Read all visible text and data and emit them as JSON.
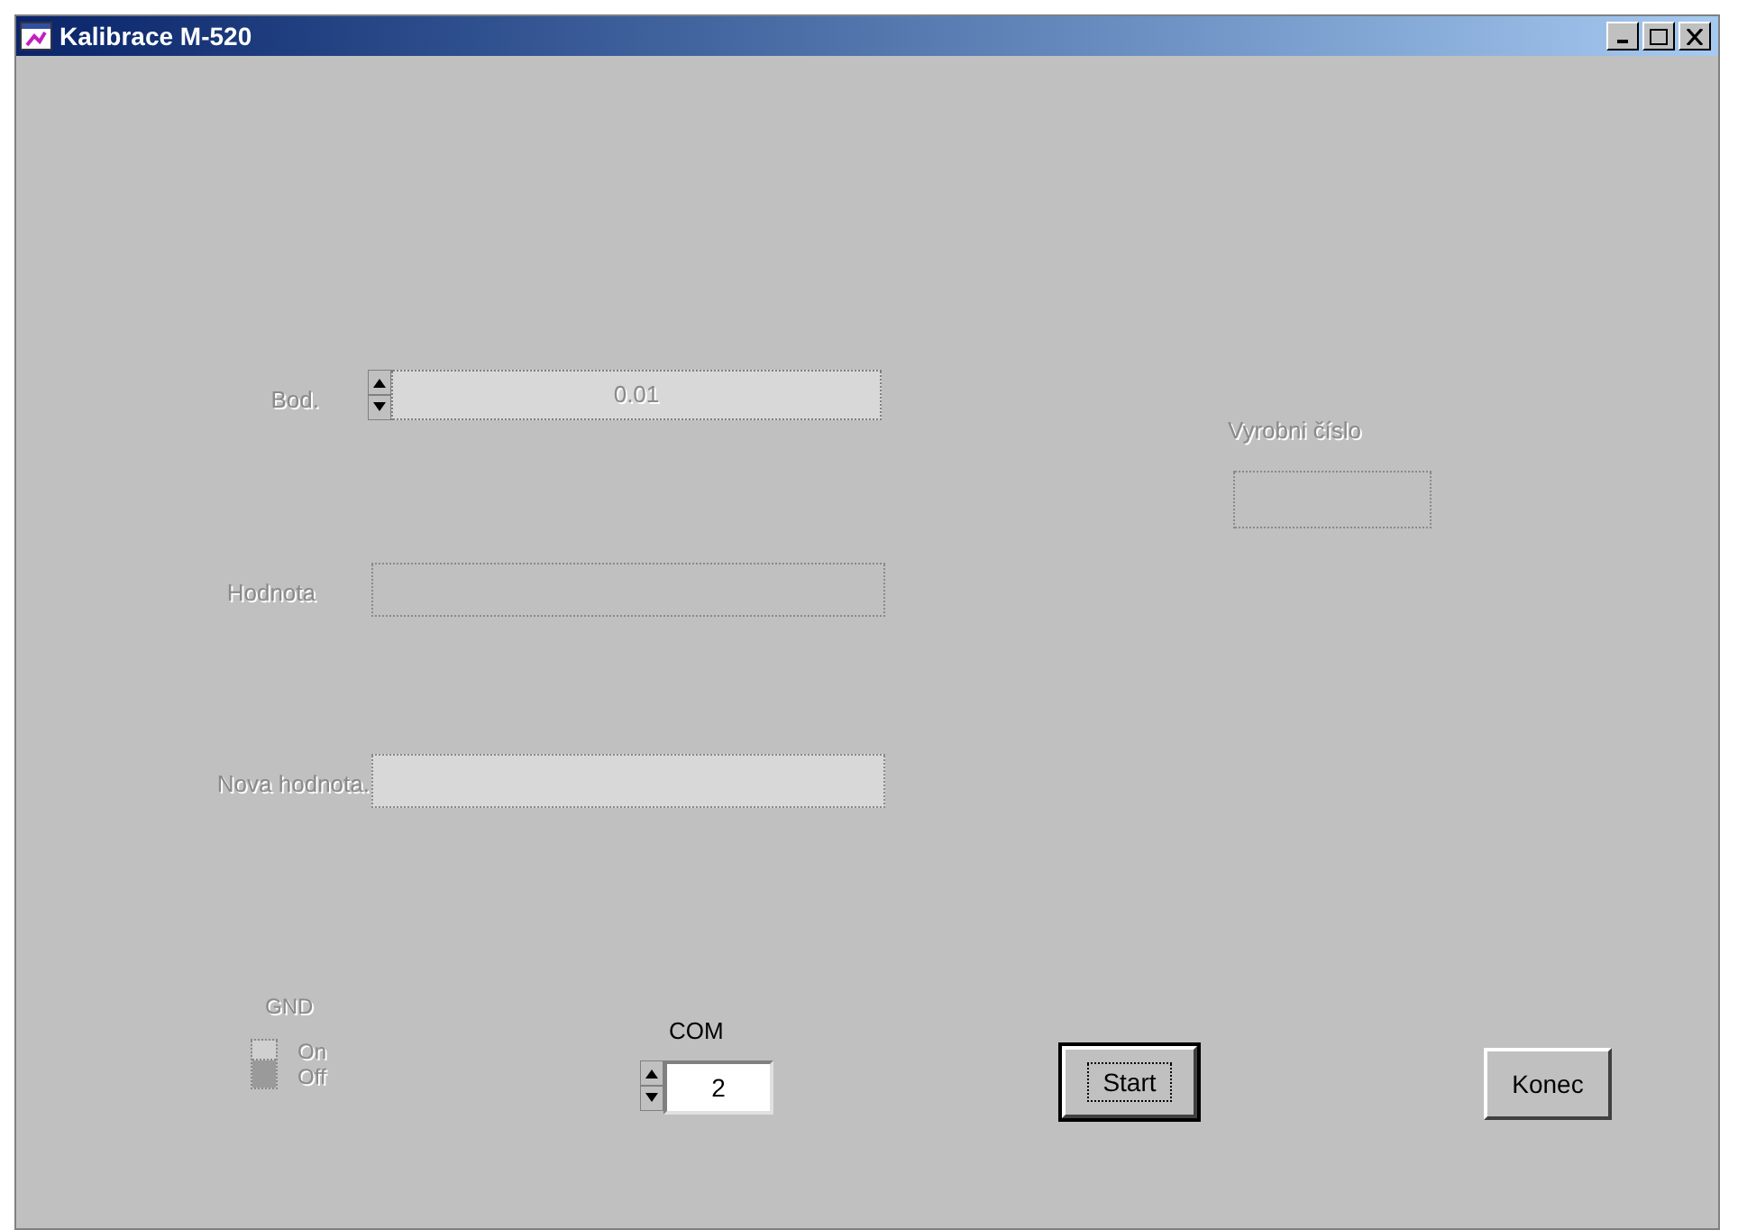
{
  "window": {
    "title": "Kalibrace M-520"
  },
  "fields": [
    {
      "kind": "spin",
      "label": "Bod.",
      "value": "0.01",
      "disabled": true
    },
    {
      "kind": "text",
      "label": "Hodnota",
      "disabled": true
    },
    {
      "kind": "hatched",
      "label": "Nova hodnota.",
      "disabled": true
    }
  ],
  "serial": {
    "label": "Vyrobni číslo",
    "disabled": true
  },
  "gnd": {
    "label": "GND",
    "on_label": "On",
    "off_label": "Off",
    "on": false,
    "disabled": true
  },
  "com": {
    "label": "COM",
    "value": "2",
    "disabled": false
  },
  "buttons": [
    {
      "label": "Start",
      "focused": true
    },
    {
      "label": "Konec",
      "focused": false
    }
  ]
}
